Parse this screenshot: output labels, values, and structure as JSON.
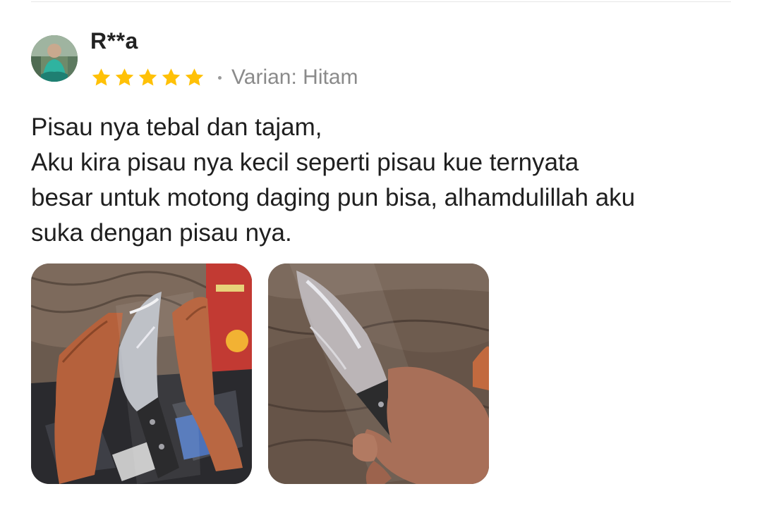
{
  "review": {
    "username": "R**a",
    "rating": 5,
    "rating_max": 5,
    "star_color": "#FFC107",
    "variant": "Varian: Hitam",
    "text_lines": [
      "Pisau nya tebal dan tajam,",
      "Aku kira pisau nya kecil seperti pisau kue ternyata",
      "besar untuk motong daging pun bisa, alhamdulillah aku",
      "suka dengan pisau nya."
    ],
    "photos": [
      {
        "name": "review-photo-1"
      },
      {
        "name": "review-photo-2"
      }
    ]
  }
}
